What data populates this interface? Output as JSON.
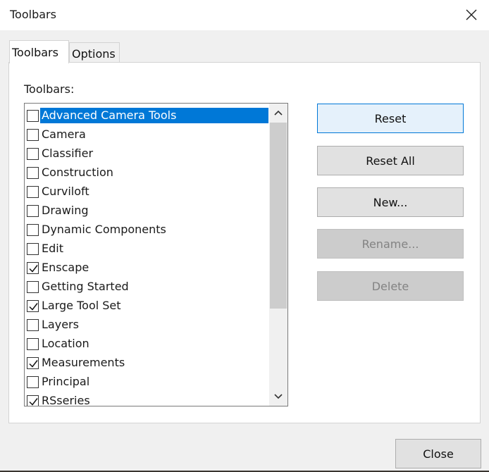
{
  "window": {
    "title": "Toolbars"
  },
  "tabs": [
    {
      "label": "Toolbars",
      "active": true
    },
    {
      "label": "Options",
      "active": false
    }
  ],
  "list_label": "Toolbars:",
  "toolbars": [
    {
      "label": "Advanced Camera Tools",
      "checked": false,
      "selected": true
    },
    {
      "label": "Camera",
      "checked": false
    },
    {
      "label": "Classifier",
      "checked": false
    },
    {
      "label": "Construction",
      "checked": false
    },
    {
      "label": "Curviloft",
      "checked": false
    },
    {
      "label": "Drawing",
      "checked": false
    },
    {
      "label": "Dynamic Components",
      "checked": false
    },
    {
      "label": "Edit",
      "checked": false
    },
    {
      "label": "Enscape",
      "checked": true
    },
    {
      "label": "Getting Started",
      "checked": false
    },
    {
      "label": "Large Tool Set",
      "checked": true
    },
    {
      "label": "Layers",
      "checked": false
    },
    {
      "label": "Location",
      "checked": false
    },
    {
      "label": "Measurements",
      "checked": true
    },
    {
      "label": "Principal",
      "checked": false
    },
    {
      "label": "RSseries",
      "checked": true
    }
  ],
  "buttons": {
    "reset": "Reset",
    "reset_all": "Reset All",
    "new": "New...",
    "rename": "Rename...",
    "delete": "Delete",
    "close": "Close"
  },
  "colors": {
    "selection": "#0078d7",
    "default_button_border": "#0078d7",
    "disabled_text": "#838383"
  }
}
